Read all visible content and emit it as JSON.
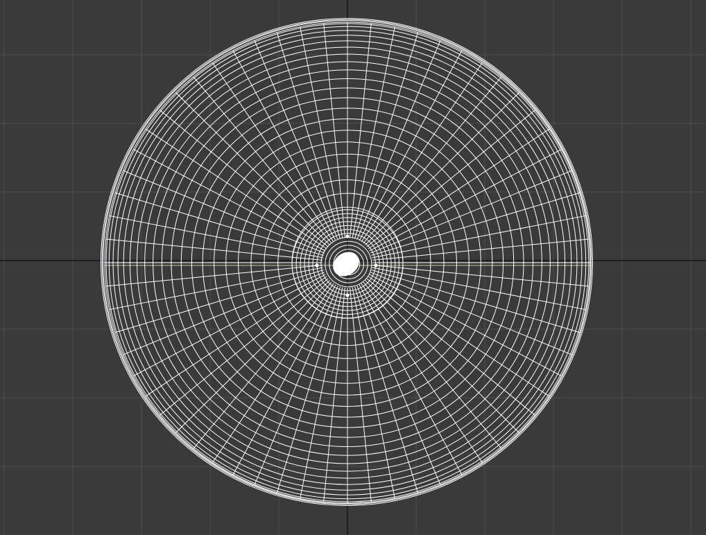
{
  "viewport": {
    "view": "top",
    "shading": "wireframe",
    "grid_visible": true,
    "background_color": "#3a3a3a",
    "grid_color": "#4f4f4f",
    "axis_color": "#0d0d0d",
    "wire_color": "#ffffff",
    "origin_highlight_color": "#e8e8b0",
    "object": {
      "type": "disc-mesh",
      "outer_rings": 22,
      "radial_segments": 64,
      "inner_rings": 12,
      "center_pole": true,
      "vertex_markers": 4
    }
  }
}
